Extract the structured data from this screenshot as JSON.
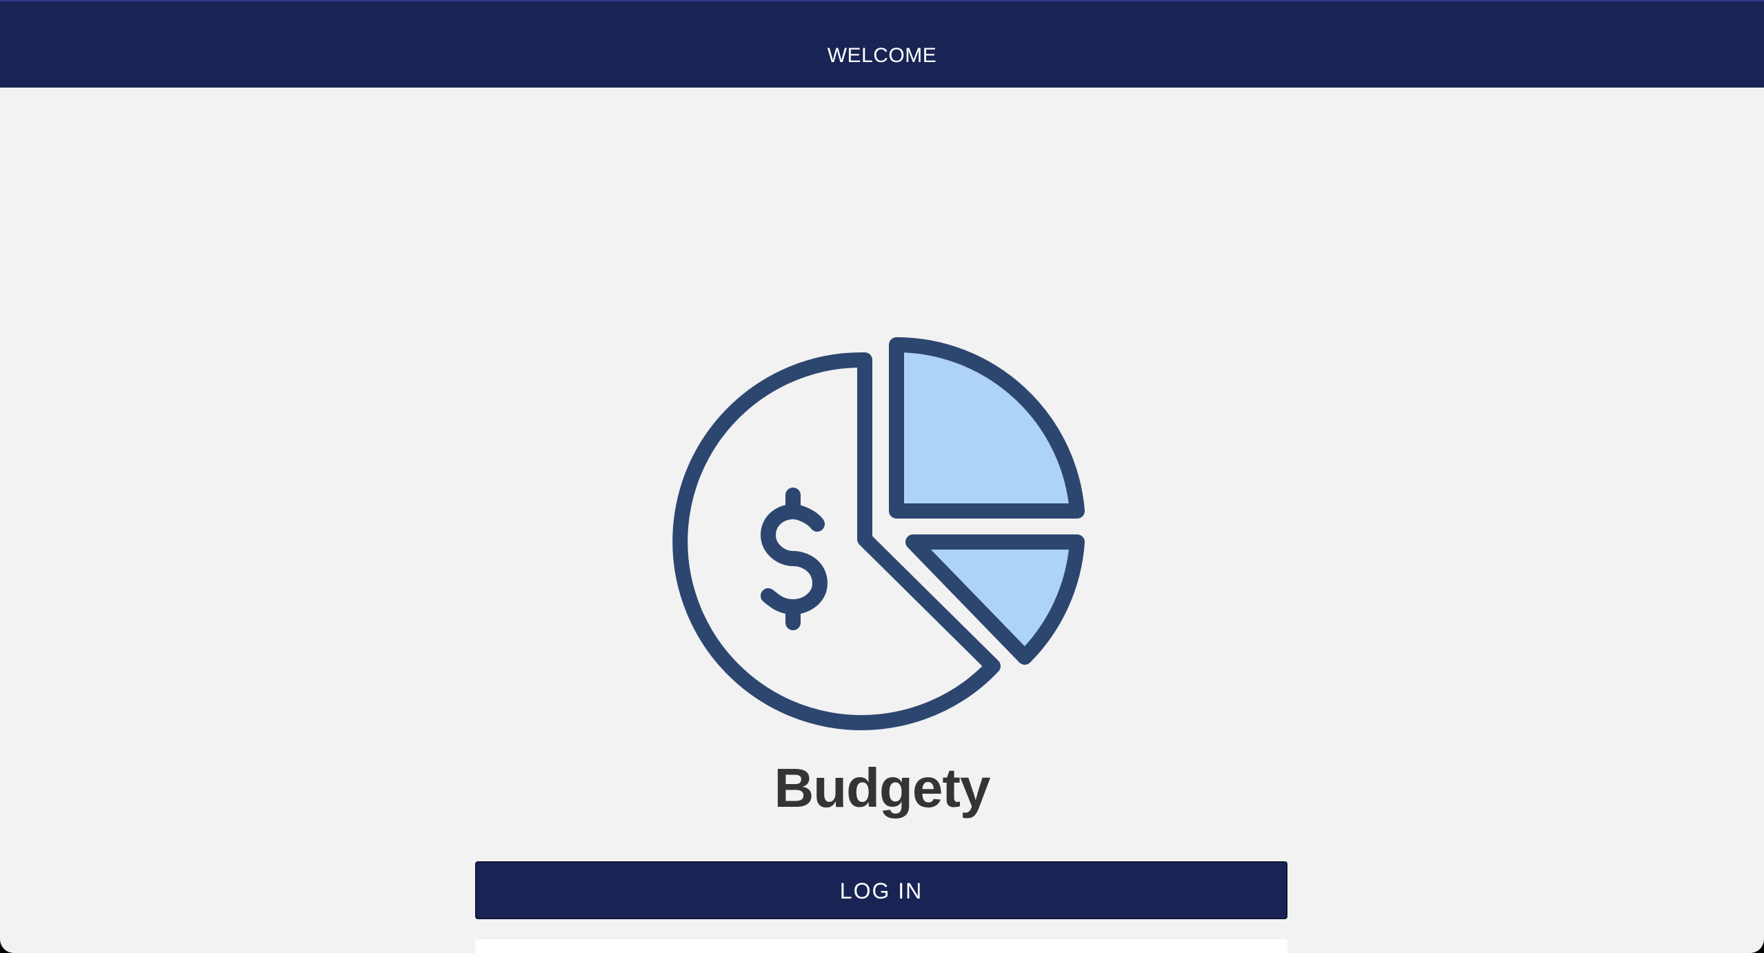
{
  "header": {
    "title": "WELCOME"
  },
  "brand": {
    "name": "Budgety",
    "logo_icon": "pie-chart-dollar-icon"
  },
  "actions": {
    "login_label": "LOG IN"
  },
  "colors": {
    "header_bg": "#192454",
    "page_bg": "#f2f2f2",
    "icon_stroke": "#2c4670",
    "icon_fill": "#aed3f8",
    "title_text": "#343434"
  }
}
